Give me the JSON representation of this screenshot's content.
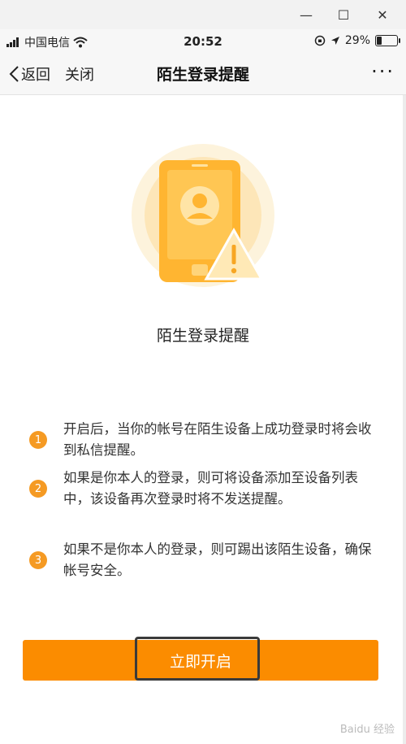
{
  "window": {
    "minimize": "—",
    "maximize": "☐",
    "close": "✕"
  },
  "status_bar": {
    "carrier": "中国电信",
    "time": "20:52",
    "battery": "29%",
    "battery_level": 0.29
  },
  "nav": {
    "back_label": "返回",
    "close_label": "关闭",
    "title": "陌生登录提醒",
    "more": "···"
  },
  "headline": "陌生登录提醒",
  "items": [
    {
      "num": "1",
      "text": "开启后，当你的帐号在陌生设备上成功登录时将会收到私信提醒。"
    },
    {
      "num": "2",
      "text": "如果是你本人的登录，则可将设备添加至设备列表中，该设备再次登录时将不发送提醒。"
    },
    {
      "num": "3",
      "text": "如果不是你本人的登录，则可踢出该陌生设备，确保帐号安全。"
    }
  ],
  "button": {
    "label": "立即开启"
  },
  "watermark": "Baidu 经验",
  "colors": {
    "accent": "#fb8c00",
    "badge": "#f59a23"
  }
}
